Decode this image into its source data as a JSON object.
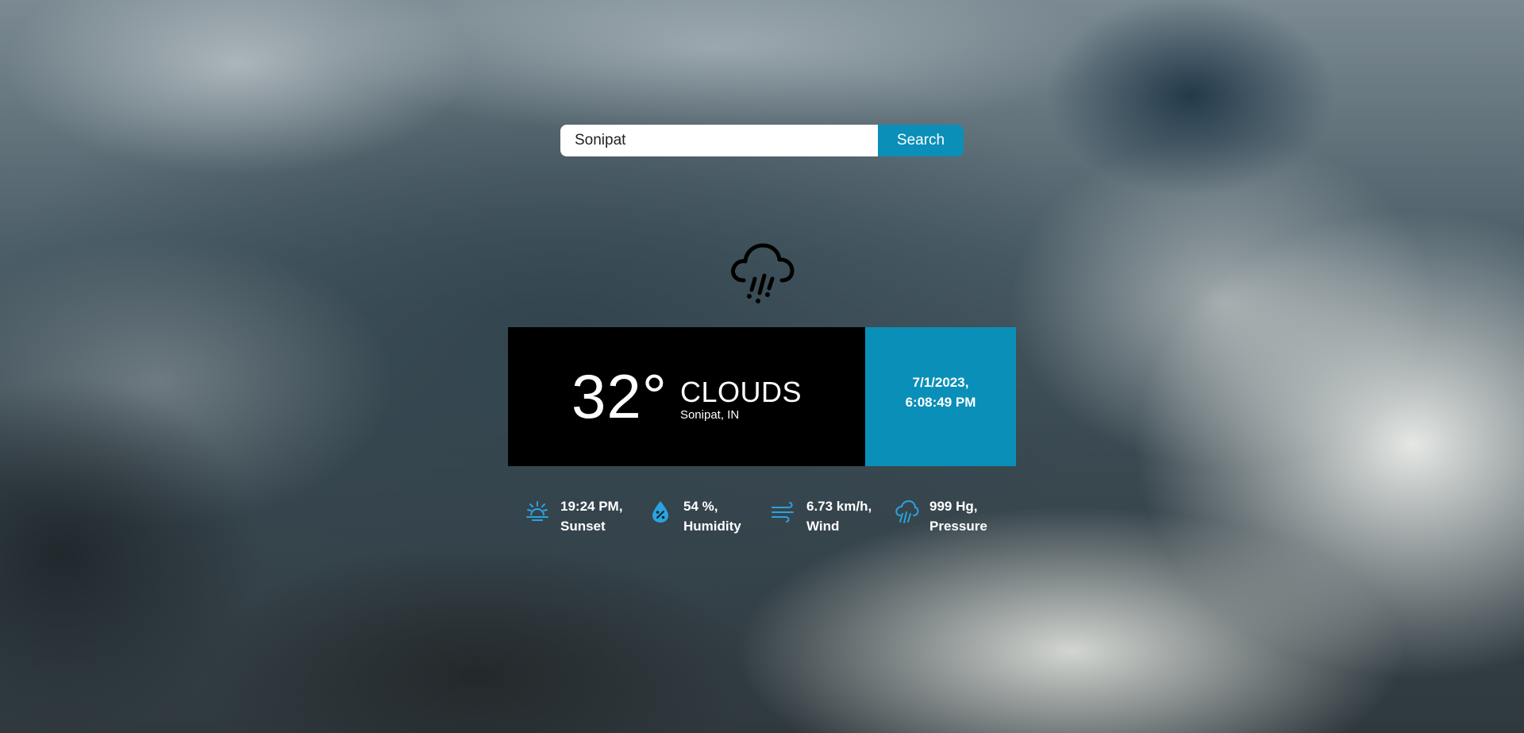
{
  "search": {
    "value": "Sonipat",
    "button_label": "Search"
  },
  "weather": {
    "icon": "rain-cloud-icon",
    "temperature": "32°",
    "condition": "CLOUDS",
    "location": "Sonipat, IN"
  },
  "datetime": {
    "date": "7/1/2023,",
    "time": "6:08:49 PM"
  },
  "stats": [
    {
      "icon": "sunset-icon",
      "value": "19:24 PM,",
      "label": "Sunset"
    },
    {
      "icon": "humidity-icon",
      "value": "54 %,",
      "label": "Humidity"
    },
    {
      "icon": "wind-icon",
      "value": "6.73 km/h,",
      "label": "Wind"
    },
    {
      "icon": "pressure-icon",
      "value": "999 Hg,",
      "label": "Pressure"
    }
  ],
  "colors": {
    "accent": "#0a8fb8",
    "card_background": "#000000",
    "icon_accent": "#2aa3e0"
  }
}
